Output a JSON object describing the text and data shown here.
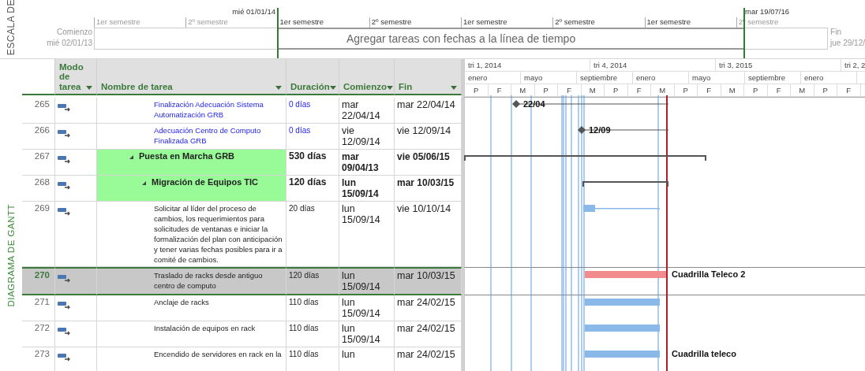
{
  "timeline": {
    "side_label": "ESCALA DE",
    "start": {
      "label": "Comienzo",
      "date": "mié 02/01/13"
    },
    "finish": {
      "label": "Fin",
      "date": "jue 29/12/"
    },
    "markers": [
      "mié 01/01/14",
      "mar 19/07/16"
    ],
    "ticks": [
      {
        "label": "1er semestre",
        "in_range": false
      },
      {
        "label": "2º semestre",
        "in_range": false
      },
      {
        "label": "1er semestre",
        "in_range": true
      },
      {
        "label": "2º semestre",
        "in_range": true
      },
      {
        "label": "1er semestre",
        "in_range": true
      },
      {
        "label": "2º semestre",
        "in_range": true
      },
      {
        "label": "1er semestre",
        "in_range": true
      },
      {
        "label": "2º semestre",
        "in_range": false
      }
    ],
    "bar_text": "Agregar tareas con fechas a la línea de tiempo"
  },
  "view_label": "DIAGRAMA DE GANTT",
  "table": {
    "columns": [
      {
        "label": "Modo de tarea",
        "filter": true
      },
      {
        "label": "Nombre de tarea",
        "filter": true
      },
      {
        "label": "Duración",
        "filter": true
      },
      {
        "label": "Comienzo",
        "filter": true
      },
      {
        "label": "Fin",
        "filter": true
      }
    ],
    "rows": [
      {
        "id": "265",
        "kind": "milestone",
        "name": "Finalización Adecuación Sistema Automatización GRB",
        "duration": "0 días",
        "start": "mar 22/04/14",
        "finish": "mar 22/04/14",
        "selected": false,
        "bar_label": "22/04"
      },
      {
        "id": "266",
        "kind": "milestone",
        "name": "Adecuación Centro de Computo Finalizada GRB",
        "duration": "0 días",
        "start": "vie 12/09/14",
        "finish": "vie 12/09/14",
        "selected": false,
        "bar_label": "12/09"
      },
      {
        "id": "267",
        "kind": "summary",
        "name": "Puesta en Marcha GRB",
        "duration": "530 días",
        "start": "mar 09/04/13",
        "finish": "vie 05/06/15",
        "selected": false,
        "expanded": true,
        "children": [
          {
            "id": "268",
            "kind": "summary",
            "name": "Migración de Equipos TIC",
            "duration": "120 días",
            "start": "lun 15/09/14",
            "finish": "mar 10/03/15",
            "selected": false,
            "expanded": true,
            "children": [
              {
                "id": "269",
                "kind": "task",
                "name": "Solicitar al líder del proceso de cambios, los requerimientos para solicitudes de ventanas e iniciar la formalización del plan con anticipación  y tener varias fechas posibles para ir a comité de cambios.",
                "duration": "20 días",
                "start": "lun 15/09/14",
                "finish": "vie 10/10/14",
                "selected": false,
                "critical": false
              },
              {
                "id": "270",
                "kind": "task",
                "name": "Traslado de racks desde antiguo centro de computo",
                "duration": "120 días",
                "start": "lun 15/09/14",
                "finish": "mar 10/03/15",
                "selected": true,
                "bar_label": "Cuadrilla Teleco 2",
                "critical": true
              },
              {
                "id": "271",
                "kind": "task",
                "name": "Anclaje de racks",
                "duration": "110 días",
                "start": "lun 15/09/14",
                "finish": "mar 24/02/15",
                "selected": false,
                "critical": false
              },
              {
                "id": "272",
                "kind": "task",
                "name": "Instalación de equipos en rack",
                "duration": "110 días",
                "start": "lun 15/09/14",
                "finish": "mar 24/02/15",
                "selected": false,
                "critical": false
              },
              {
                "id": "273",
                "kind": "task",
                "name": "Encendido de servidores en rack en la",
                "duration": "110 días",
                "start": "lun",
                "finish": "mar 24/02/15",
                "selected": false,
                "bar_label": "Cuadrilla teleco",
                "critical": false
              }
            ]
          }
        ]
      }
    ]
  },
  "gantt": {
    "quarters": [
      "tri 1, 2014",
      "tri 4, 2014",
      "tri 3, 2015",
      "tri 2, 2"
    ],
    "months": [
      "enero",
      "mayo",
      "septiembre",
      "enero",
      "mayo",
      "septiembre",
      "enero"
    ],
    "periods": [
      "P",
      "F",
      "M",
      "P",
      "F",
      "M",
      "P",
      "F",
      "M",
      "P",
      "F",
      "M",
      "P",
      "F",
      "M",
      "P",
      "F"
    ]
  }
}
